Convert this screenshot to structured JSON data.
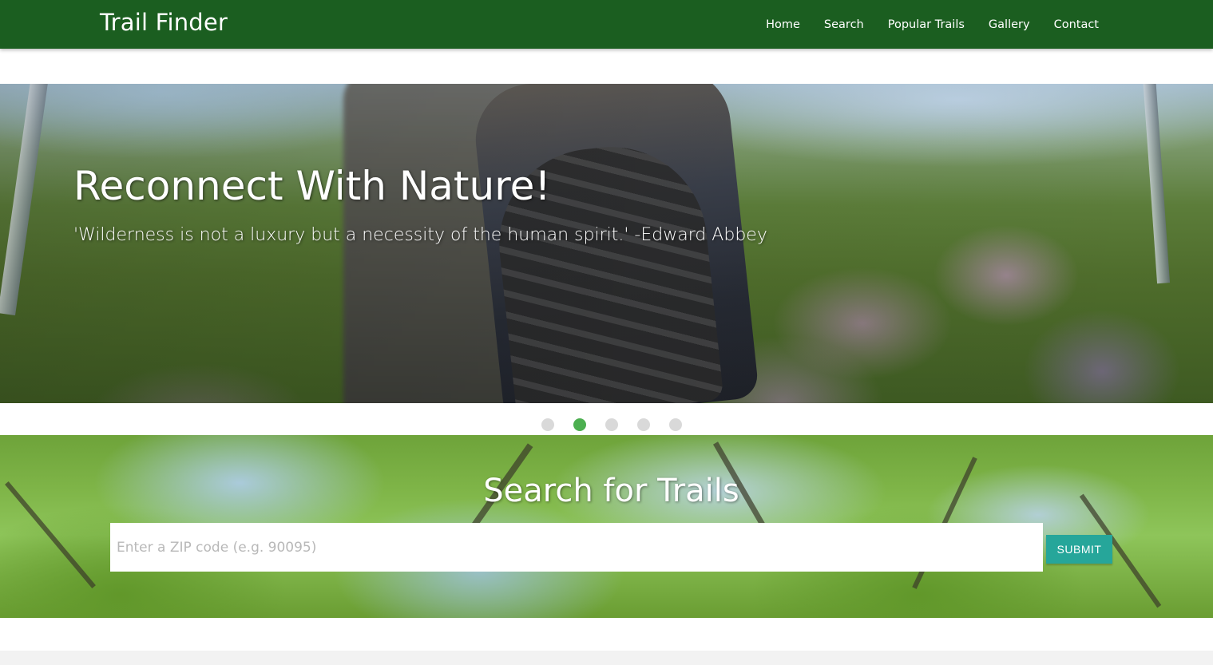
{
  "navbar": {
    "brand": "Trail Finder",
    "links": [
      {
        "label": "Home"
      },
      {
        "label": "Search"
      },
      {
        "label": "Popular Trails"
      },
      {
        "label": "Gallery"
      },
      {
        "label": "Contact"
      }
    ],
    "color": "#1b5e20"
  },
  "carousel": {
    "heading": "Reconnect With Nature!",
    "quote": "'Wilderness is not a luxury but a necessity of the human spirit.' -Edward Abbey",
    "slide_count": 5,
    "active_index": 1,
    "active_color": "#4caf50",
    "inactive_color": "#d9d9d9"
  },
  "search": {
    "title": "Search for Trails",
    "placeholder": "Enter a ZIP code (e.g. 90095)",
    "value": "",
    "submit_label": "SUBMIT",
    "submit_color": "#26a69a"
  }
}
